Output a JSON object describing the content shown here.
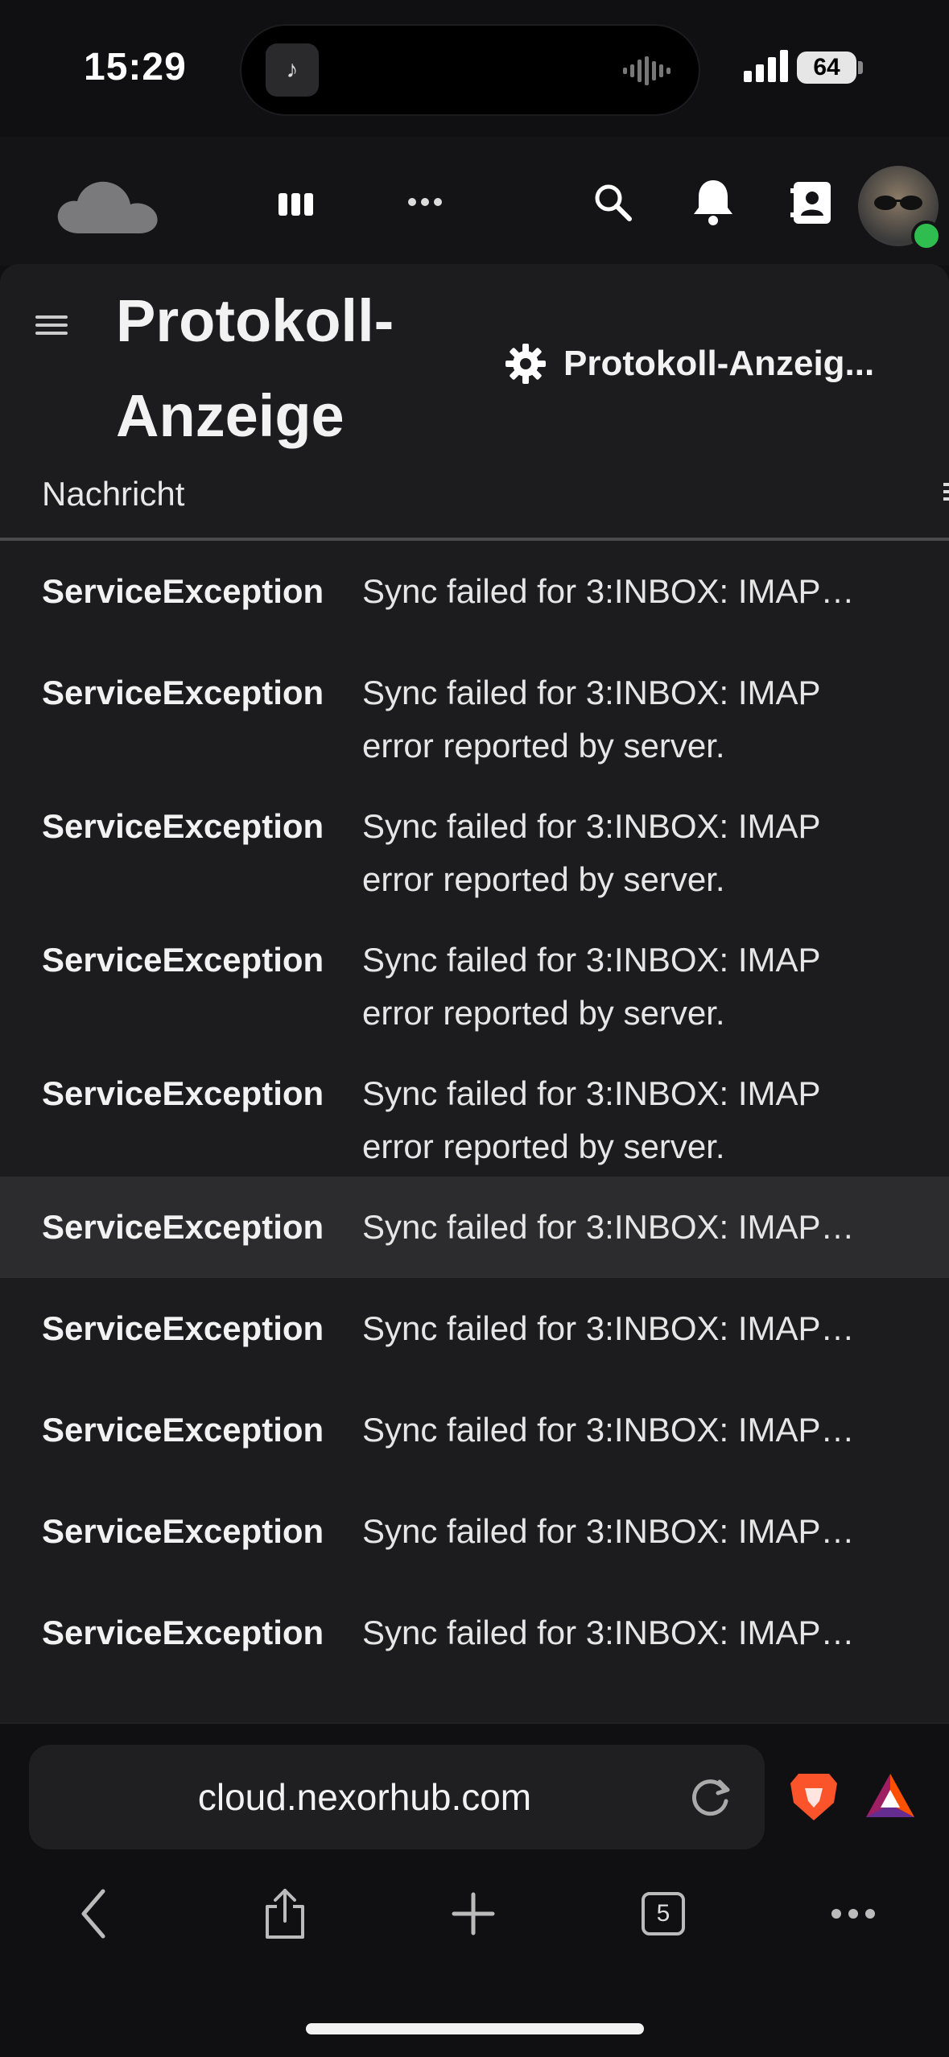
{
  "status_bar": {
    "time": "15:29",
    "battery": "64",
    "island_app_icon": "tiktok-icon"
  },
  "app_header": {
    "icons": [
      "cloud-logo-icon",
      "apps-icon",
      "more-apps-icon",
      "search-icon",
      "notifications-icon",
      "contacts-icon",
      "avatar"
    ]
  },
  "page": {
    "title": "Protokoll-Anzeige",
    "settings_label": "Protokoll-Anzeig...",
    "column_header": "Nachricht"
  },
  "log_rows": [
    {
      "level": "ServiceException",
      "message": "Sync failed for 3:INBOX: IMAP…"
    },
    {
      "level": "ServiceException",
      "message": "Sync failed for 3:INBOX: IMAP error reported by server."
    },
    {
      "level": "ServiceException",
      "message": "Sync failed for 3:INBOX: IMAP error reported by server."
    },
    {
      "level": "ServiceException",
      "message": "Sync failed for 3:INBOX: IMAP error reported by server."
    },
    {
      "level": "ServiceException",
      "message": "Sync failed for 3:INBOX: IMAP error reported by server."
    },
    {
      "level": "ServiceException",
      "message": "Sync failed for 3:INBOX: IMAP…"
    },
    {
      "level": "ServiceException",
      "message": "Sync failed for 3:INBOX: IMAP…"
    },
    {
      "level": "ServiceException",
      "message": "Sync failed for 3:INBOX: IMAP…"
    },
    {
      "level": "ServiceException",
      "message": "Sync failed for 3:INBOX: IMAP…"
    },
    {
      "level": "ServiceException",
      "message": "Sync failed for 3:INBOX: IMAP…"
    }
  ],
  "browser": {
    "url": "cloud.nexorhub.com",
    "tab_count": "5"
  },
  "colors": {
    "background": "#101012",
    "panel": "#1c1c1e",
    "highlight_row": "#2c2c2e",
    "online_status": "#2fbd4f",
    "brave_orange": "#fb542b"
  }
}
